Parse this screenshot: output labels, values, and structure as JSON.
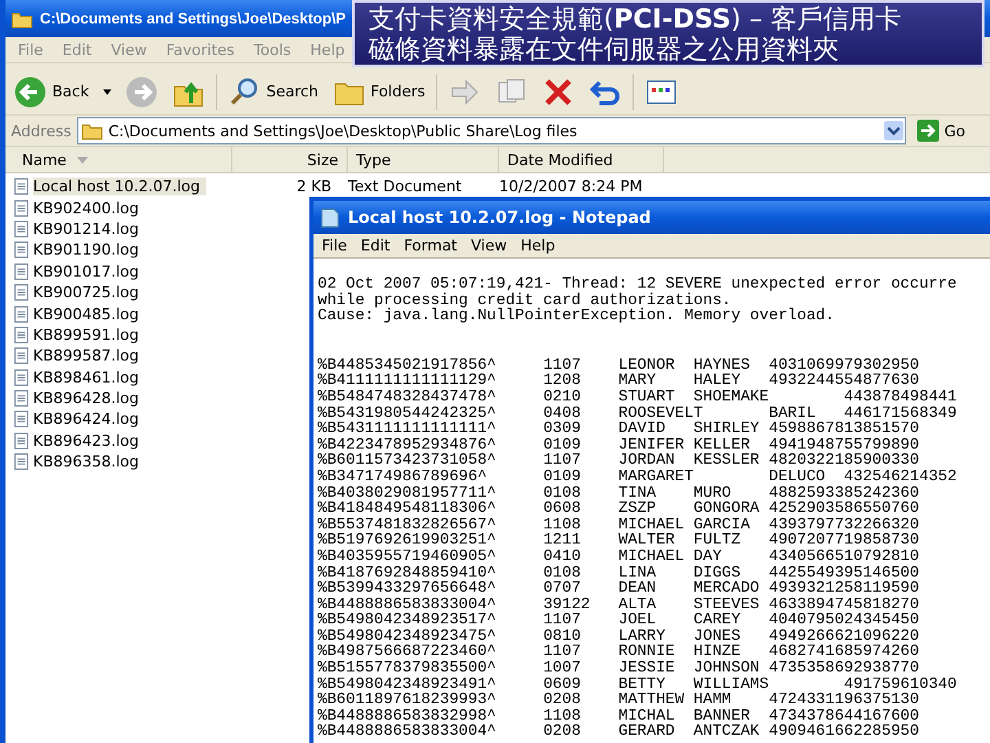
{
  "explorer": {
    "title": "C:\\Documents and Settings\\Joe\\Desktop\\P",
    "menu": [
      "File",
      "Edit",
      "View",
      "Favorites",
      "Tools",
      "Help"
    ],
    "toolbar": {
      "back": "Back",
      "search": "Search",
      "folders": "Folders"
    },
    "address": {
      "label": "Address",
      "path": "C:\\Documents and Settings\\Joe\\Desktop\\Public Share\\Log files",
      "go": "Go"
    },
    "columns": [
      "Name",
      "Size",
      "Type",
      "Date Modified"
    ],
    "files": [
      {
        "name": "Local host 10.2.07.log",
        "size": "2 KB",
        "type": "Text Document",
        "modified": "10/2/2007 8:24 PM",
        "selected": true
      },
      {
        "name": "KB902400.log",
        "selected": false
      },
      {
        "name": "KB901214.log",
        "selected": false
      },
      {
        "name": "KB901190.log",
        "selected": false
      },
      {
        "name": "KB901017.log",
        "selected": false
      },
      {
        "name": "KB900725.log",
        "selected": false
      },
      {
        "name": "KB900485.log",
        "selected": false
      },
      {
        "name": "KB899591.log",
        "selected": false
      },
      {
        "name": "KB899587.log",
        "selected": false
      },
      {
        "name": "KB898461.log",
        "selected": false
      },
      {
        "name": "KB896428.log",
        "selected": false
      },
      {
        "name": "KB896424.log",
        "selected": false
      },
      {
        "name": "KB896423.log",
        "selected": false
      },
      {
        "name": "KB896358.log",
        "selected": false
      }
    ]
  },
  "notepad": {
    "title": "Local host 10.2.07.log - Notepad",
    "menu": [
      "File",
      "Edit",
      "Format",
      "View",
      "Help"
    ],
    "message_lines": [
      "02 Oct 2007 05:07:19,421- Thread: 12 SEVERE unexpected error occurre",
      "while processing credit card authorizations.",
      "Cause: java.lang.NullPointerException. Memory overload."
    ],
    "records": [
      "%B4485345021917856^\t1107\tLEONOR\tHAYNES\t4031069979302950",
      "%B4111111111111129^\t1208\tMARY\tHALEY\t4932244554877630",
      "%B5484748328437478^\t0210\tSTUART\tSHOEMAKE\t443878498441",
      "%B5431980544242325^\t0408\tROOSEVELT\tBARIL\t446171568349",
      "%B5431111111111111^\t0309\tDAVID\tSHIRLEY\t4598867813851570",
      "%B4223478952934876^\t0109\tJENIFER\tKELLER\t4941948755799890",
      "%B6011573423731058^\t1107\tJORDAN\tKESSLER\t4820322185900330",
      "%B347174986789696^\t0109\tMARGARET\tDELUCO\t432546214352",
      "%B4038029081957711^\t0108\tTINA\tMURO\t4882593385242360",
      "%B4184849548118306^\t0608\tZSZP\tGONGORA\t4252903586550760",
      "%B5537481832826567^\t1108\tMICHAEL\tGARCIA\t4393797732266320",
      "%B5197692619903251^\t1211\tWALTER\tFULTZ\t4907207719858730",
      "%B4035955719460905^\t0410\tMICHAEL\tDAY\t4340566510792810",
      "%B4187692848859410^\t0108\tLINA\tDIGGS\t4425549395146500",
      "%B5399433297656648^\t0707\tDEAN\tMERCADO\t4939321258119590",
      "%B4488886583833004^\t39122\tALTA\tSTEEVES\t4633894745818270",
      "%B5498042348923517^\t1107\tJOEL\tCAREY\t4040795024345450",
      "%B5498042348923475^\t0810\tLARRY\tJONES\t4949266621096220",
      "%B4987566687223460^\t1107\tRONNIE\tHINZE\t4682741685974260",
      "%B5155778379835500^\t1007\tJESSIE\tJOHNSON\t4735358692938770",
      "%B5498042348923491^\t0609\tBETTY\tWILLIAMS\t491759610340",
      "%B6011897618239993^\t0208\tMATTHEW\tHAMM\t4724331196375130",
      "%B4488886583832998^\t1108\tMICHAL\tBANNER\t4734378644167600",
      "%B4488886583833004^\t0208\tGERARD\tANTCZAK\t4909461662285950"
    ]
  },
  "banner": {
    "lines": [
      "支付卡資料安全規範(**PCI-DSS**) – 客戶信用卡",
      "磁條資料暴露在文件伺服器之公用資料夾"
    ]
  }
}
